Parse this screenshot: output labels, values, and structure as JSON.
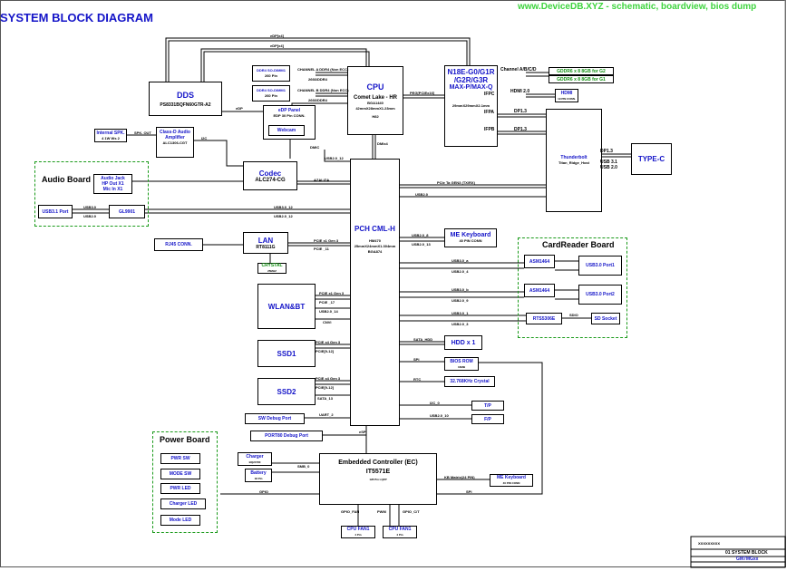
{
  "header": {
    "title": "SYSTEM BLOCK DIAGRAM",
    "watermark": "www.DeviceDB.XYZ - schematic, boardview, bios dump"
  },
  "colors": {
    "accent_blue": "#1414c8",
    "group_green": "#1a9a1a",
    "watermark_green": "#3ed43e"
  },
  "blocks": {
    "dds": {
      "title": "DDS",
      "part": "PS8331BQFN60GTR-A2"
    },
    "cpu": {
      "title": "CPU",
      "line1": "Comet Lake - HR",
      "line2": "BGA1440",
      "line3": "42mmX28mmX1.23mm",
      "line4": "H82"
    },
    "gpu": {
      "line1": "N18E-G0/G1R",
      "line2": "/G2R/G3R",
      "line3": "MAX-P/MAX-Q",
      "line4": "29mmX29mmX2.1mm",
      "p1": "IFPC",
      "p2": "IFPA",
      "p3": "IFPB"
    },
    "ddr_a": {
      "line1": "DDR4 SO-DIMM1",
      "line2": "260 Pin"
    },
    "ddr_b": {
      "line1": "DDR4 SO-DIMM1",
      "line2": "260 Pin"
    },
    "edp": {
      "line1": "eDP Panel",
      "line2": "EDP 30 Pin CONN."
    },
    "webcam": {
      "title": "Webcam"
    },
    "speaker": {
      "line1": "Internal SPK.",
      "line2": "4   1W Ws 2"
    },
    "amp": {
      "line1": "Class-D Audio",
      "line2": "Amplifier",
      "line3": "ALC1306-CGT"
    },
    "codec": {
      "title": "Codec",
      "part": "ALC274-CG"
    },
    "audio_jack": {
      "line1": "Audio Jack",
      "line2": "HP Out X1",
      "line3": "Mic In X1"
    },
    "usb31_port": {
      "title": "USB3.1 Port"
    },
    "gl9901": {
      "title": "GL9901"
    },
    "lan": {
      "title": "LAN",
      "part": "RT8111G"
    },
    "rj45": {
      "title": "RJ45 CONN."
    },
    "crystal": {
      "line1": "CRYSTAL",
      "line2": "25MHZ"
    },
    "wlan": {
      "title": "WLAN&BT"
    },
    "ssd1": {
      "title": "SSD1"
    },
    "ssd2": {
      "title": "SSD2"
    },
    "sw_debug": {
      "title": "SW Debug Port"
    },
    "port80": {
      "title": "PORT80 Debug Port"
    },
    "pch": {
      "title": "PCH CML-H",
      "line1": "HM470",
      "line2": "25mmX24mmX1.304mm",
      "line3": "BGA874"
    },
    "me_kb_top": {
      "title": "ME Keyboard",
      "sub": "40  PIN  CONN"
    },
    "asm1": {
      "title": "ASM1464"
    },
    "asm2": {
      "title": "ASM1464"
    },
    "usb30_p1": {
      "title": "USB3.0 Port1"
    },
    "usb30_p2": {
      "title": "USB3.0 Port2"
    },
    "rts": {
      "title": "RTS5306E"
    },
    "sd": {
      "title": "SD Socket"
    },
    "hdd": {
      "title": "HDD x 1"
    },
    "bios": {
      "title": "BIOS ROM",
      "sub": "16MB"
    },
    "xtal": {
      "title": "32.768KHz Crystal"
    },
    "tp": {
      "title": "T/P"
    },
    "fp": {
      "title": "F/P"
    },
    "tb": {
      "title": "Thunderbolt",
      "sub": "Titan_Ridge_Host"
    },
    "typec": {
      "title": "TYPE-C"
    },
    "hdmi": {
      "line1": "HDMI",
      "line2": "19 PIN CONN."
    },
    "gddr1": {
      "title": "GDDR6 x 8 8GB for G2"
    },
    "gddr2": {
      "title": "GDDR6 x 8 8GB for G1"
    },
    "ec": {
      "title": "Embedded Controller (EC)",
      "part": "IT5571E",
      "sub": "128 Pin LQFP"
    },
    "charger": {
      "title": "Charger",
      "sub": "BQ24780"
    },
    "battery": {
      "title": "Battery",
      "sub": "18 Pin"
    },
    "me_kb_bot": {
      "title": "ME Keyboard",
      "sub": "40 PIN CONN"
    },
    "fan1": {
      "title": "CPU FAN1",
      "sub": "4 Pin"
    },
    "fan2": {
      "title": "CPU FAN1",
      "sub": "4 Pin"
    },
    "pwr_sw": {
      "title": "PWR SW"
    },
    "mode_sw": {
      "title": "MODE SW"
    },
    "pwr_led": {
      "title": "PWR LED"
    },
    "chg_led": {
      "title": "Charger LED"
    },
    "mode_led": {
      "title": "Mode LED"
    }
  },
  "groups": {
    "audio": "Audio Board",
    "card": "CardReader Board",
    "power": "Power Board"
  },
  "signals": {
    "edp_top1": "eDP[x4]",
    "edp_top2": "eDP[x4]",
    "ch_a": "CHANNEL A DDR4 (Non ECC)",
    "ch_b": "CHANNEL B DDR4 (Non ECC)",
    "spd_a": "2666/DDR4",
    "spd_b": "2666/DDR4",
    "edp_l": "eDP",
    "peg": "PEG[PCIEx16]",
    "dmi": "DMIx4",
    "chan_gddr": "Channel A/B/C/D",
    "hdmi20": "HDMI 2.0",
    "dp13a": "DP1.3",
    "dp13b": "DP1.3",
    "dp13c": "DP1.3",
    "usb31": "USB 3.1",
    "usb20": "USB 2.0",
    "spk": "SPK. OUT",
    "i2c": "I2C",
    "dmic": "DMIC",
    "usb2_12": "USB2.0_12",
    "hda": "AZALIZA",
    "pcie_tb": "PCIe Ta GEN3 (TX/RX)",
    "usb2_tb": "USB2.0",
    "u30": "USB3.0",
    "u20": "USB2.0",
    "u30_12": "USB3.0_12",
    "u20_12": "USB2.0_12",
    "pcie_lan": "PCIE x1 Gen 3",
    "lan_11": "PCIE _11",
    "usb2_8": "USB2.0_8",
    "usb2_13": "USB2.0_13",
    "usb3_a": "USB3.0_a",
    "usb2_4": "USB2.0_4",
    "usb3_b": "USB3.0_b",
    "usb2_9": "USB2.0_9",
    "usb3_1": "USB3.0_1",
    "usb2_3": "USB2.0_3",
    "pcie_w": "PCIE x1 Gen 3",
    "pcie_w2": "PCIE _17",
    "usb2_14": "USB2.0_14",
    "cnvi": "CNVi",
    "pcie_s1": "PCIE x4 Gen 3",
    "pcie_s1b": "PCIE[9-12]",
    "pcie_s2": "PCIE x4 Gen 3",
    "pcie_s2b": "PCIE[9-12]",
    "sata13": "SATA_13",
    "sata_hdd": "SATA_HDD",
    "spi": "SPI",
    "rtc": "RTC",
    "i2c_tp": "I2C_0",
    "usb2_fp": "USB2.0_10",
    "uart": "UART_2",
    "espi": "eSPI",
    "lpc": "LPC",
    "smb": "SMB_0",
    "gpio": "GPIO",
    "kbm": "KB Matrix(24 PIN)",
    "spi2": "SPI",
    "gpio_fan": "GPIO_FAN",
    "pwm": "PWM",
    "gpio_c": "GPIO_C/T",
    "sdio": "SDIO"
  },
  "footer": {
    "company": "XXXXXXXXX",
    "doc_title": "01  SYSTEM BLOCK",
    "model": "GM7MGxx"
  }
}
